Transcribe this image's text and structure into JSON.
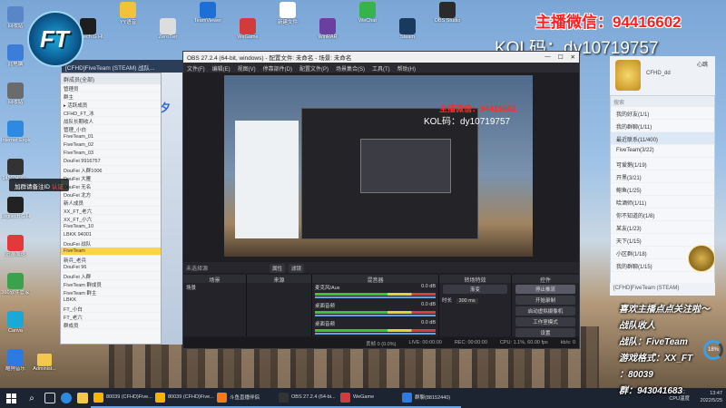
{
  "overlay": {
    "wechat": "主播微信：94416602",
    "kol": "KOL码：dy10719757",
    "team_logo_text": "FT",
    "caption1": "喜欢主播点点关注啦～",
    "caption2": "战队收人",
    "caption3": "战队：FiveTeam",
    "caption4": "游戏格式：XX_FT",
    "caption5": "：80039",
    "caption6": "群：943041683"
  },
  "desktop": {
    "left_icons": [
      {
        "label": "回收站",
        "color": "#5a86c8",
        "icon": "recycle-bin-icon"
      },
      {
        "label": "此电脑",
        "color": "#3b7dd8",
        "icon": "computer-icon"
      },
      {
        "label": "回收站",
        "color": "#6b6b6b",
        "icon": "bin-icon"
      },
      {
        "label": "Internet Explorer",
        "color": "#2d8ae0",
        "icon": "ie-icon"
      },
      {
        "label": "14503490...",
        "color": "#333333",
        "icon": "file-icon"
      },
      {
        "label": "Logitech G HUB",
        "color": "#222222",
        "icon": "logitech-icon"
      },
      {
        "label": "迅游加速",
        "color": "#e23a3a",
        "icon": "xunyou-icon"
      },
      {
        "label": "360软件管家",
        "color": "#3aa14d",
        "icon": "360-icon"
      },
      {
        "label": "Canva",
        "color": "#1aa8d6",
        "icon": "canva-icon"
      },
      {
        "label": "酷狗音乐",
        "color": "#2d7ae0",
        "icon": "kugou-icon"
      }
    ],
    "top_icons": [
      {
        "label": "Logitech G HUB",
        "color": "#1e1e1e"
      },
      {
        "label": "YY语音",
        "color": "#f2c23a"
      },
      {
        "label": "ZeroTier",
        "color": "#dddddd"
      },
      {
        "label": "TeamViewer",
        "color": "#1d6fd6"
      },
      {
        "label": "WeGame",
        "color": "#d23b3b"
      },
      {
        "label": "新建文件",
        "color": "#ffffff"
      },
      {
        "label": "WinRAR",
        "color": "#6b3fa0"
      },
      {
        "label": "WeChat",
        "color": "#37b24d"
      },
      {
        "label": "Steam",
        "color": "#173a5e"
      },
      {
        "label": "OBS Studio",
        "color": "#2b2b2b"
      }
    ],
    "admin_label": "Administ...",
    "note_pill_text": "加群请备注ID",
    "note_pill_red": "认证",
    "mid_text": "夕"
  },
  "qq_window": {
    "title": "[CFHD]FiveTeam (STEAM) 战队...",
    "header": "群成员(全部)",
    "rows": [
      "管理员",
      "群主",
      "▸ 活跃成员",
      "CFHD_FT_冰",
      "战队长期收人",
      "管理_小白",
      "FiveTeam_01",
      "FiveTeam_02",
      "FiveTeam_03",
      "DouFei 9916757",
      "DouFei 入群1006",
      "DouFei 大雁",
      "DouFei 无名",
      "DouFei 北方",
      "新人成员",
      "XX_FT_老六",
      "XX_FT_小六",
      "FiveTeam_10",
      "LBKK 94001",
      "DouFei 战队",
      "FiveTeam",
      "新兵_老兵",
      "DouFei 96",
      "DouFei 入群",
      "FiveTeam 群成员",
      "FiveTeam 群主",
      "LBKK",
      "FT_小白",
      "FT_老六",
      "群成员"
    ],
    "selected_row": 20
  },
  "obs": {
    "title": "OBS 27.2.4 (64-bit, windows) - 配置文件: 未命名 - 场景: 未命名",
    "menu": [
      "文件(F)",
      "编辑(E)",
      "视图(V)",
      "停靠部件(D)",
      "配置文件(P)",
      "场景集合(S)",
      "工具(T)",
      "帮助(H)"
    ],
    "no_source": "未选择源",
    "tool_buttons": [
      "属性",
      "滤镜"
    ],
    "docks": {
      "scenes": {
        "title": "场景",
        "items": [
          "场景"
        ]
      },
      "sources": {
        "title": "来源",
        "items": []
      },
      "mixer": {
        "title": "混音器",
        "tracks": [
          {
            "name": "麦克风/Aux",
            "db": "0.0 dB"
          },
          {
            "name": "桌面音频",
            "db": "0.0 dB"
          },
          {
            "name": "桌面音频",
            "db": "0.0 dB"
          }
        ]
      },
      "transitions": {
        "title": "转场特效",
        "mode": "渐变",
        "duration_label": "时长",
        "duration": "300 ms"
      },
      "controls": {
        "title": "控件",
        "buttons": [
          "停止推流",
          "开始录制",
          "启动虚拟摄像机",
          "工作室模式",
          "设置",
          "退出"
        ]
      }
    },
    "status": {
      "dropped": "丢帧 0 (0.0%)",
      "live": "LIVE: 00:00:00",
      "rec": "REC: 00:00:00",
      "cpu": "CPU: 1.1%, 60.00 fps",
      "kbps": "kb/s: 0"
    },
    "preview": {
      "wechat": "主播微信：94416602",
      "kol": "KOL码：dy10719757"
    }
  },
  "right_panel": {
    "avatar_name": "CFHD_dd",
    "top_label": "心跳",
    "search_placeholder": "搜索",
    "rows": [
      "我的好友(1/1)",
      "我的群聊(1/11)",
      "最近联系(11/400)",
      "FiveTeam(3/22)",
      "可爱鹅(1/19)",
      "开黑(3/21)",
      "鲍鱼(1/25)",
      "哈酒师(1/11)",
      "你不知道的(1/8)",
      "某友(1/23)",
      "天下(1/15)",
      "小区群(1/18)",
      "我的群聊(1/15)"
    ],
    "selected_row": 2,
    "bottom_text": "[CFHD]FiveTeam (STEAM)"
  },
  "taskbar": {
    "tasks": [
      {
        "label": "80039 (CFHD)Five...",
        "color": "#f5b400"
      },
      {
        "label": "80039 (CFHD)Five...",
        "color": "#f5b400"
      },
      {
        "label": "斗鱼直播伴侣",
        "color": "#f27a1a"
      },
      {
        "label": "OBS 27.2.4 (64-bi...",
        "color": "#333333"
      },
      {
        "label": "WeGame",
        "color": "#d23b3b"
      },
      {
        "label": "群聊(88152440)",
        "color": "#2d7ae0"
      }
    ],
    "tray_temp": "50°C",
    "tray_cpu": "CPU温度",
    "time": "13:47",
    "date": "2022/5/25",
    "cpu_ring": "18%"
  }
}
